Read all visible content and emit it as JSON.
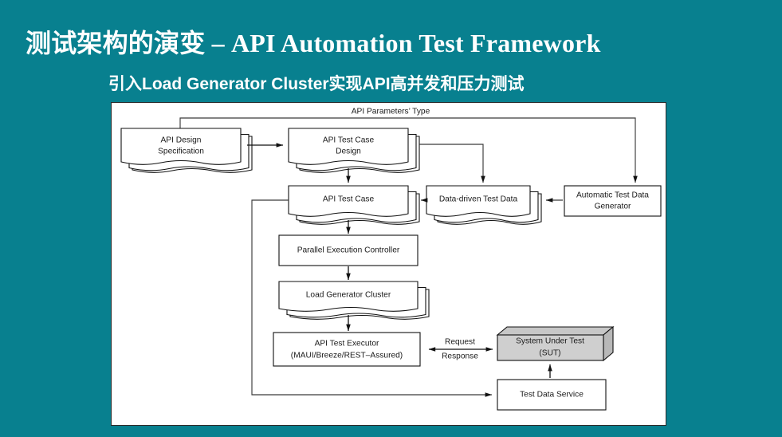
{
  "slide": {
    "background_color": "#08808f",
    "title": "测试架构的演变 – API Automation Test Framework",
    "subtitle": "引入Load Generator Cluster实现API高并发和压力测试"
  },
  "diagram": {
    "panel_background": "#ffffff",
    "edge_label_top": "API Parameters’ Type",
    "edge_label_request": "Request",
    "edge_label_response": "Response",
    "nodes": [
      {
        "id": "api-design-specification",
        "label_line1": "API Design",
        "label_line2": "Specification",
        "shape": "stacked-document"
      },
      {
        "id": "api-test-case-design",
        "label_line1": "API Test Case",
        "label_line2": "Design",
        "shape": "stacked-document"
      },
      {
        "id": "api-test-case",
        "label_line1": "API Test Case",
        "label_line2": "",
        "shape": "stacked-document"
      },
      {
        "id": "data-driven-test-data",
        "label_line1": "Data-driven Test Data",
        "label_line2": "",
        "shape": "stacked-document"
      },
      {
        "id": "automatic-test-data-generator",
        "label_line1": "Automatic Test Data",
        "label_line2": "Generator",
        "shape": "rectangle"
      },
      {
        "id": "parallel-execution-controller",
        "label_line1": "Parallel Execution Controller",
        "label_line2": "",
        "shape": "rectangle"
      },
      {
        "id": "load-generator-cluster",
        "label_line1": "Load Generator Cluster",
        "label_line2": "",
        "shape": "stacked-document"
      },
      {
        "id": "api-test-executor",
        "label_line1": "API Test Executor",
        "label_line2": "(MAUI/Breeze/REST–Assured)",
        "shape": "rectangle"
      },
      {
        "id": "system-under-test",
        "label_line1": "System Under Test",
        "label_line2": "(SUT)",
        "shape": "node-3d",
        "fill_color": "#cfcfcf"
      },
      {
        "id": "test-data-service",
        "label_line1": "Test Data Service",
        "label_line2": "",
        "shape": "rectangle"
      }
    ]
  }
}
